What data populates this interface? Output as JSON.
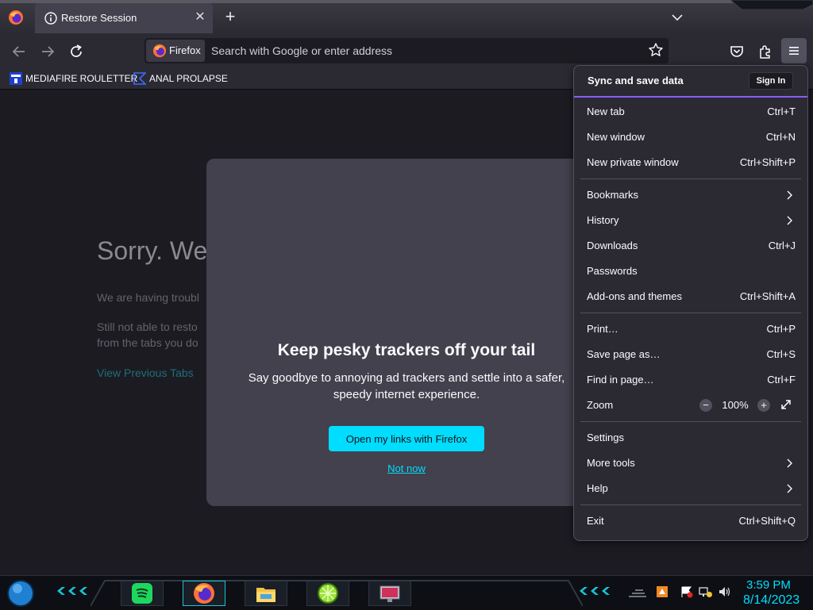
{
  "tab": {
    "title": "Restore Session"
  },
  "urlbar": {
    "identity_label": "Firefox",
    "placeholder": "Search with Google or enter address"
  },
  "bookmarks": [
    {
      "label": "MEDIAFIRE ROULETTER",
      "icon": "mediafire-favicon"
    },
    {
      "label": "ANAL PROLAPSE",
      "icon": "bookmark-favicon"
    }
  ],
  "page": {
    "title": "Sorry. We’",
    "line1": "We are having troubl",
    "line2a": "Still not able to resto",
    "line2b": "from the tabs you do",
    "link": "View Previous Tabs"
  },
  "modal": {
    "title": "Keep pesky trackers off your tail",
    "body": "Say goodbye to annoying ad trackers and settle into a safer, speedy internet experience.",
    "primary": "Open my links with Firefox",
    "secondary": "Not now"
  },
  "menu": {
    "sync_label": "Sync and save data",
    "sign_in": "Sign In",
    "items": [
      {
        "label": "New tab",
        "shortcut": "Ctrl+T"
      },
      {
        "label": "New window",
        "shortcut": "Ctrl+N"
      },
      {
        "label": "New private window",
        "shortcut": "Ctrl+Shift+P"
      },
      {
        "label": "Bookmarks",
        "shortcut": ""
      },
      {
        "label": "History",
        "shortcut": ""
      },
      {
        "label": "Downloads",
        "shortcut": "Ctrl+J"
      },
      {
        "label": "Passwords",
        "shortcut": ""
      },
      {
        "label": "Add-ons and themes",
        "shortcut": "Ctrl+Shift+A"
      },
      {
        "label": "Print…",
        "shortcut": "Ctrl+P"
      },
      {
        "label": "Save page as…",
        "shortcut": "Ctrl+S"
      },
      {
        "label": "Find in page…",
        "shortcut": "Ctrl+F"
      },
      {
        "label": "Zoom",
        "shortcut": ""
      },
      {
        "label": "Settings",
        "shortcut": ""
      },
      {
        "label": "More tools",
        "shortcut": ""
      },
      {
        "label": "Help",
        "shortcut": ""
      },
      {
        "label": "Exit",
        "shortcut": "Ctrl+Shift+Q"
      }
    ],
    "zoom": {
      "value": "100%",
      "minus": "−",
      "plus": "+"
    }
  },
  "taskbar": {
    "apps": [
      "spotify",
      "firefox",
      "file-explorer",
      "lime-app",
      "display-app"
    ],
    "time": "3:59 PM",
    "date": "8/14/2023"
  },
  "colors": {
    "accent": "#00ddff",
    "menu_bg": "#2b2a33",
    "modal_bg": "#42414d",
    "page_bg": "#1c1b22",
    "sync_underline": "#8a5cf5"
  }
}
